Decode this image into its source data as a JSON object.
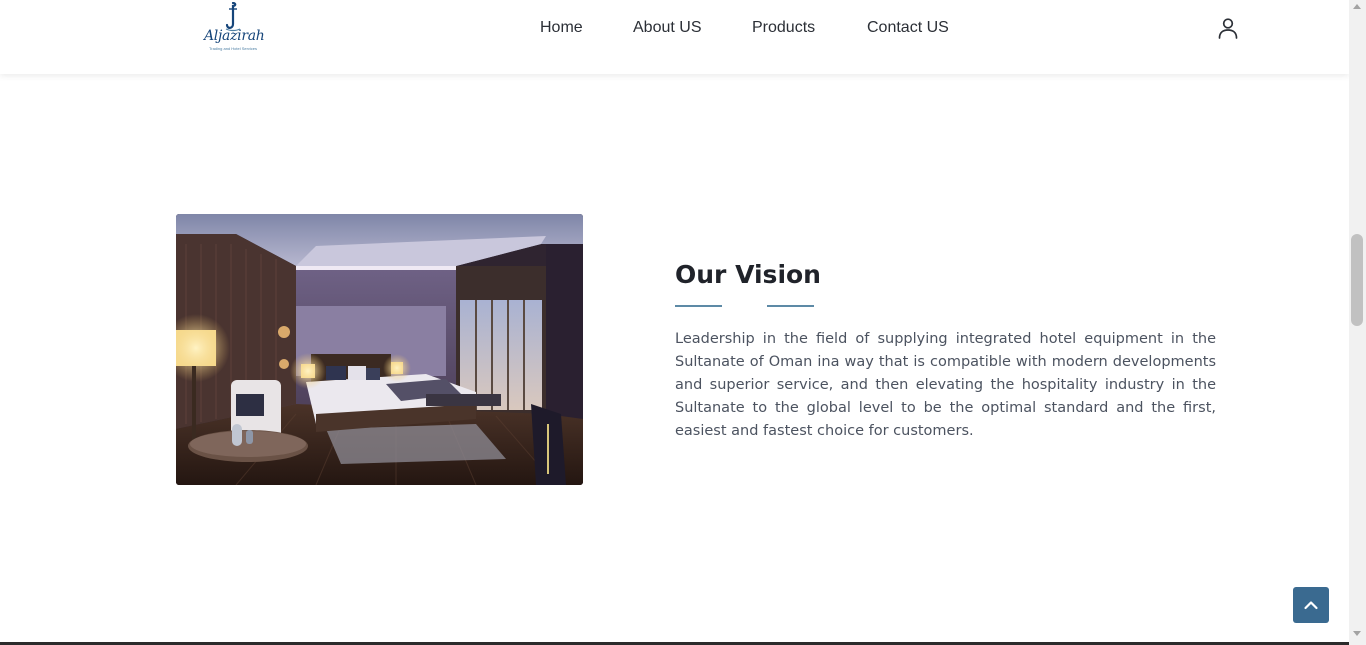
{
  "header": {
    "logo": {
      "name": "Aljazirah",
      "tagline": "Trading and Hotel Services",
      "color": "#16457a"
    },
    "nav": [
      {
        "label": "Home"
      },
      {
        "label": "About US"
      },
      {
        "label": "Products"
      },
      {
        "label": "Contact US"
      }
    ],
    "user_icon": "user-icon"
  },
  "vision": {
    "image_alt": "hotel-bedroom-photo",
    "title": "Our Vision",
    "text": "Leadership in the field of supplying integrated hotel equipment in the Sultanate of Oman ina way that is compatible with modern developments and superior service, and then elevating the hospitality industry in the Sultanate to the global level to be the optimal standard and the first, easiest and fastest choice for customers."
  },
  "back_to_top": {
    "icon": "chevron-up-icon",
    "color": "#3a6a90"
  },
  "colors": {
    "accent_bar": "#5d8aa6",
    "title": "#20232a",
    "body_text": "#4c5360"
  }
}
